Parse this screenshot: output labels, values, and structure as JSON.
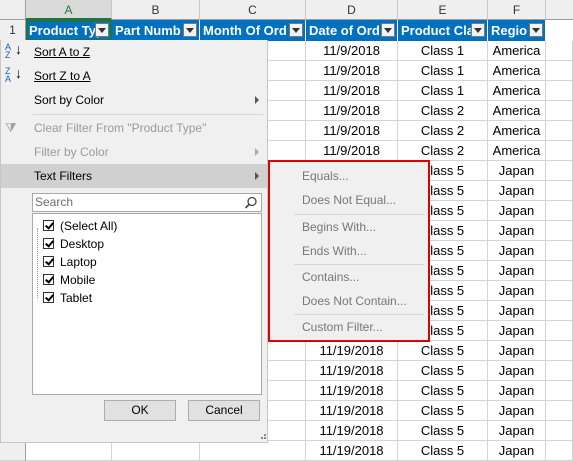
{
  "columns": [
    "A",
    "B",
    "C",
    "D",
    "E",
    "F"
  ],
  "row_header_first": "1",
  "headers": [
    "Product Typ",
    "Part Numb",
    "Month Of Ord",
    "Date of Ord",
    "Product Cla",
    "Regio"
  ],
  "rows": [
    {
      "date": "11/9/2018",
      "cls": "Class 1",
      "region": "America"
    },
    {
      "date": "11/9/2018",
      "cls": "Class 1",
      "region": "America"
    },
    {
      "date": "11/9/2018",
      "cls": "Class 1",
      "region": "America"
    },
    {
      "date": "11/9/2018",
      "cls": "Class 2",
      "region": "America"
    },
    {
      "date": "11/9/2018",
      "cls": "Class 2",
      "region": "America"
    },
    {
      "date": "11/9/2018",
      "cls": "Class 2",
      "region": "America"
    },
    {
      "date": "",
      "cls": "Class 5",
      "region": "Japan"
    },
    {
      "date": "",
      "cls": "Class 5",
      "region": "Japan"
    },
    {
      "date": "",
      "cls": "Class 5",
      "region": "Japan"
    },
    {
      "date": "",
      "cls": "Class 5",
      "region": "Japan"
    },
    {
      "date": "",
      "cls": "Class 5",
      "region": "Japan"
    },
    {
      "date": "",
      "cls": "Class 5",
      "region": "Japan"
    },
    {
      "date": "",
      "cls": "Class 5",
      "region": "Japan"
    },
    {
      "date": "",
      "cls": "Class 5",
      "region": "Japan"
    },
    {
      "date": "",
      "cls": "Class 5",
      "region": "Japan"
    },
    {
      "date": "11/19/2018",
      "cls": "Class 5",
      "region": "Japan"
    },
    {
      "date": "11/19/2018",
      "cls": "Class 5",
      "region": "Japan"
    },
    {
      "date": "11/19/2018",
      "cls": "Class 5",
      "region": "Japan"
    },
    {
      "date": "11/19/2018",
      "cls": "Class 5",
      "region": "Japan"
    },
    {
      "date": "11/19/2018",
      "cls": "Class 5",
      "region": "Japan"
    },
    {
      "date": "11/19/2018",
      "cls": "Class 5",
      "region": "Japan"
    }
  ],
  "menu": {
    "sort_az": "Sort A to Z",
    "sort_za": "Sort Z to A",
    "sort_by_color": "Sort by Color",
    "clear_filter": "Clear Filter From \"Product Type\"",
    "filter_by_color": "Filter by Color",
    "text_filters": "Text Filters",
    "search_placeholder": "Search",
    "items": [
      "(Select All)",
      "Desktop",
      "Laptop",
      "Mobile",
      "Tablet"
    ],
    "ok": "OK",
    "cancel": "Cancel"
  },
  "submenu": [
    "Equals...",
    "Does Not Equal...",
    "Begins With...",
    "Ends With...",
    "Contains...",
    "Does Not Contain...",
    "Custom Filter..."
  ],
  "colors": {
    "header_blue": "#0070c0",
    "highlight_red": "#e00000",
    "excel_green": "#217346"
  }
}
